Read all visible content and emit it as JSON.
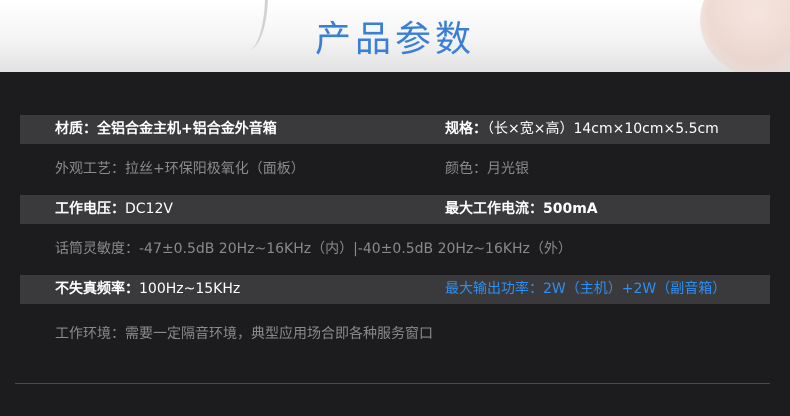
{
  "header": {
    "title": "产品参数"
  },
  "specs": [
    {
      "style": "dark",
      "left": {
        "label": "材质：",
        "value": "全铝合金主机+铝合金外音箱"
      },
      "right": {
        "label": "规格：",
        "value": "（长×宽×高）14cm×10cm×5.5cm"
      }
    },
    {
      "style": "plain",
      "left": {
        "label": "外观工艺：",
        "value": "拉丝+环保阳极氧化（面板）"
      },
      "right": {
        "label": "颜色：",
        "value": "月光银"
      }
    },
    {
      "style": "dark",
      "left": {
        "label": "工作电压：",
        "value": "DC12V"
      },
      "right": {
        "label": "最大工作电流：",
        "value": "500mA"
      }
    },
    {
      "style": "plain",
      "left": {
        "label": "话筒灵敏度：",
        "value": "-47±0.5dB 20Hz~16KHz（内）|-40±0.5dB 20Hz~16KHz（外）"
      }
    },
    {
      "style": "dark",
      "left": {
        "label": "不失真频率：",
        "value": "100Hz~15KHz"
      },
      "right": {
        "label": "最大输出功率：",
        "value": "2W（主机）+2W（副音箱）",
        "color": "#2f8ff0"
      }
    },
    {
      "style": "plain",
      "left": {
        "label": "工作环境：",
        "value": "需要一定隔音环境，典型应用场合即各种服务窗口"
      }
    }
  ]
}
